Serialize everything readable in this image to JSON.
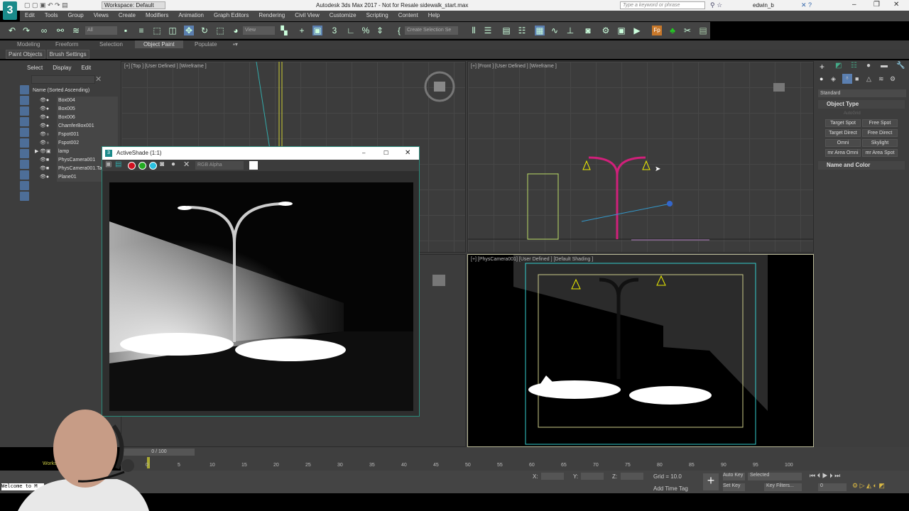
{
  "titlebar": {
    "workspace": "Workspace: Default",
    "title": "Autodesk 3ds Max 2017 - Not for Resale   sidewalk_start.max",
    "search_placeholder": "Type a keyword or phrase",
    "user": "edwin_b",
    "logo": "3"
  },
  "menu": [
    "Edit",
    "Tools",
    "Group",
    "Views",
    "Create",
    "Modifiers",
    "Animation",
    "Graph Editors",
    "Rendering",
    "Civil View",
    "Customize",
    "Scripting",
    "Content",
    "Help"
  ],
  "toolbar": {
    "selection_filter": "All",
    "ref_coord": "View",
    "named_selection": "Create Selection Se"
  },
  "ribbon": {
    "tabs": [
      "Modeling",
      "Freeform",
      "Selection",
      "Object Paint",
      "Populate"
    ],
    "active": "Object Paint",
    "subtabs": [
      "Paint Objects",
      "Brush Settings"
    ]
  },
  "explorer": {
    "menu": [
      "Select",
      "Display",
      "Edit"
    ],
    "header": "Name (Sorted Ascending)",
    "items": [
      "Box004",
      "Box005",
      "Box006",
      "ChamferBox001",
      "Fspot001",
      "Fspot002",
      "lamp",
      "PhysCamera001",
      "PhysCamera001.Ta",
      "Plane01"
    ]
  },
  "viewports": {
    "top": "[+] [Top ] [User Defined ] [Wireframe ]",
    "front": "[+] [Front ] [User Defined ] [Wireframe ]",
    "camera": "[+] [PhysCamera001] [User Defined ] [Default Shading ]"
  },
  "activeshade": {
    "title": "ActiveShade (1:1)",
    "channel": "RGB Alpha"
  },
  "command_panel": {
    "category": "Standard",
    "rollout_object_type": "Object Type",
    "autogrid": "AutoGrid",
    "buttons": [
      "Target Spot",
      "Free Spot",
      "Target Direct",
      "Free Direct",
      "Omni",
      "Skylight",
      "mr Area Omni",
      "mr Area Spot"
    ],
    "rollout_name_color": "Name and Color"
  },
  "timeline": {
    "frame": "0 / 100",
    "ticks": [
      "0",
      "5",
      "10",
      "15",
      "20",
      "25",
      "30",
      "35",
      "40",
      "45",
      "50",
      "55",
      "60",
      "65",
      "70",
      "75",
      "80",
      "85",
      "90",
      "95",
      "100"
    ]
  },
  "status": {
    "x_label": "X:",
    "y_label": "Y:",
    "z_label": "Z:",
    "grid": "Grid = 10.0",
    "add_time_tag": "Add Time Tag",
    "auto_key": "Auto Key",
    "set_key": "Set Key",
    "key_mode": "Selected",
    "key_filters": "Key Filters...",
    "current_frame": "0",
    "workspace": "Workspace: D",
    "listener": "Welcome to M"
  }
}
